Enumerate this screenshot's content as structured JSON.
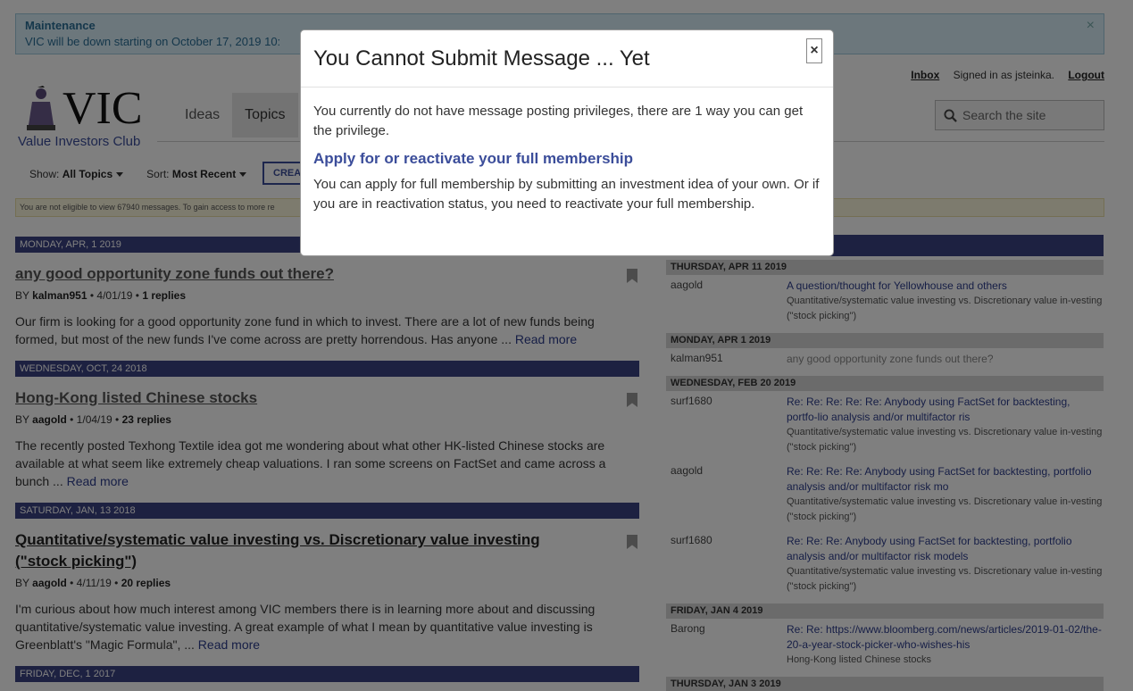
{
  "maintenance": {
    "title": "Maintenance",
    "message": "VIC will be down starting on October 17, 2019 10:",
    "close": "×"
  },
  "userbar": {
    "inbox": "Inbox",
    "signed_in": "Signed in as jsteinka.",
    "logout": "Logout"
  },
  "logo": {
    "name": "VIC",
    "subtitle": "Value Investors Club"
  },
  "nav": {
    "items": [
      "Ideas",
      "Topics"
    ]
  },
  "search": {
    "placeholder": "Search the site"
  },
  "filters": {
    "show_label": "Show:",
    "show_value": "All Topics",
    "sort_label": "Sort:",
    "sort_value": "Most Recent",
    "create_label": "CREATE"
  },
  "notice": "You are not eligible to view 67940 messages. To gain access to more re",
  "posts": [
    {
      "date": "MONDAY, APR, 1 2019",
      "title": "any good opportunity zone funds out there?",
      "by": "BY",
      "author": "kalman951",
      "meta_rest": " • 4/01/19 • ",
      "replies": "1 replies",
      "body": "Our firm is looking for a good opportunity zone fund in which to invest.  There are a lot of new funds being formed, but most of the new funds I've come across are pretty horrendous. Has anyone ... ",
      "read_more": "Read more"
    },
    {
      "date": "WEDNESDAY, OCT, 24 2018",
      "title": "Hong-Kong listed Chinese stocks",
      "by": "BY",
      "author": "aagold",
      "meta_rest": " • 1/04/19 • ",
      "replies": "23 replies",
      "body": "The recently posted Texhong Textile idea got me wondering about what other HK-listed Chinese stocks are available at what seem like extremely cheap valuations.  I ran some screens on FactSet and came across a bunch ... ",
      "read_more": "Read more"
    },
    {
      "date": "SATURDAY, JAN, 13 2018",
      "title": "Quantitative/systematic value investing vs. Discretionary value investing (\"stock picking\")",
      "by": "BY",
      "author": "aagold",
      "meta_rest": " • 4/11/19 • ",
      "replies": "20 replies",
      "body": "I'm curious about how much interest among VIC members there is in learning more about and discussing quantitative/systematic value investing.  A great example of what I mean by quantitative value investing is Greenblatt's \"Magic Formula\", ... ",
      "read_more": "Read more"
    }
  ],
  "next_date": "FRIDAY, DEC, 1 2017",
  "recent": [
    {
      "date": "THURSDAY, APR 11 2019",
      "rows": [
        {
          "user": "aagold",
          "link": "A question/thought for Yellowhouse and others",
          "sub": "Quantitative/systematic value investing vs. Discretionary value in-vesting (\"stock picking\")"
        }
      ]
    },
    {
      "date": "MONDAY, APR 1 2019",
      "rows": [
        {
          "user": "kalman951",
          "plain": "any good opportunity zone funds out there?"
        }
      ]
    },
    {
      "date": "WEDNESDAY, FEB 20 2019",
      "rows": [
        {
          "user": "surf1680",
          "link": "Re: Re: Re: Re: Re: Anybody using FactSet for backtesting, portfo-lio analysis and/or multifactor ris",
          "sub": "Quantitative/systematic value investing vs. Discretionary value in-vesting (\"stock picking\")"
        },
        {
          "user": "aagold",
          "link": "Re: Re: Re: Re: Anybody using FactSet for backtesting, portfolio analysis and/or multifactor risk mo",
          "sub": "Quantitative/systematic value investing vs. Discretionary value in-vesting (\"stock picking\")"
        },
        {
          "user": "surf1680",
          "link": "Re: Re: Re: Anybody using FactSet for backtesting, portfolio analysis and/or multifactor risk models",
          "sub": "Quantitative/systematic value investing vs. Discretionary value in-vesting (\"stock picking\")"
        }
      ]
    },
    {
      "date": "FRIDAY, JAN 4 2019",
      "rows": [
        {
          "user": "Barong",
          "link": "Re: Re: https://www.bloomberg.com/news/articles/2019-01-02/the-20-a-year-stock-picker-who-wishes-his",
          "sub": "Hong-Kong listed Chinese stocks"
        }
      ]
    },
    {
      "date": "THURSDAY, JAN 3 2019",
      "rows": []
    }
  ],
  "modal": {
    "title": "You Cannot Submit Message ... Yet",
    "close": "×",
    "intro": "You currently do not have message posting privileges, there are 1 way you can get the privilege.",
    "heading": "Apply for or reactivate your full membership",
    "body": "You can apply for full membership by submitting an investment idea of your own. Or if you are in reactivation status, you need to reactivate your full membership."
  }
}
